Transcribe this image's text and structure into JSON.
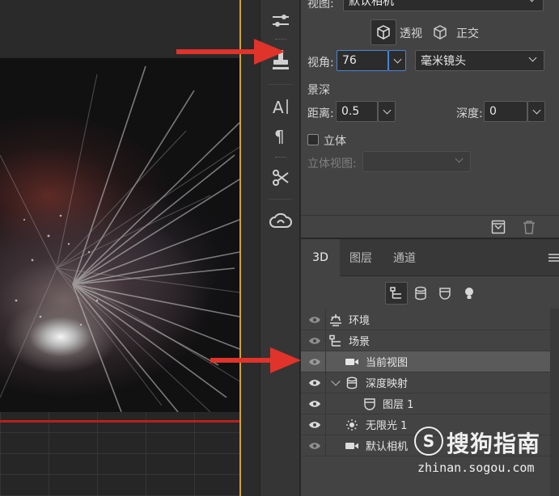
{
  "properties": {
    "view_label": "视图:",
    "view_value": "默认相机",
    "perspective_label": "透视",
    "orthographic_label": "正交",
    "fov_label": "视角:",
    "fov_value": "76",
    "lens_unit": "毫米镜头",
    "dof_heading": "景深",
    "distance_label": "距离:",
    "distance_value": "0.5",
    "depth_label": "深度:",
    "depth_value": "0",
    "stereo_label": "立体",
    "stereo_view_label": "立体视图:"
  },
  "panel3d": {
    "tabs": [
      "3D",
      "图层",
      "通道"
    ],
    "active_tab": "3D",
    "rows": [
      {
        "label": "环境",
        "icon": "environment-icon",
        "indent": 0,
        "visible": true,
        "selected": false
      },
      {
        "label": "场景",
        "icon": "scene-icon",
        "indent": 0,
        "visible": true,
        "selected": false
      },
      {
        "label": "当前视图",
        "icon": "camera-icon",
        "indent": 1,
        "visible": true,
        "selected": true
      },
      {
        "label": "深度映射",
        "icon": "mesh-icon",
        "indent": 1,
        "visible": true,
        "selected": false,
        "expanded": true
      },
      {
        "label": "图层 1",
        "icon": "material-icon",
        "indent": 2,
        "visible": true,
        "selected": false
      },
      {
        "label": "无限光 1",
        "icon": "light-icon",
        "indent": 1,
        "visible": true,
        "selected": false
      },
      {
        "label": "默认相机",
        "icon": "camera-icon",
        "indent": 1,
        "visible": true,
        "selected": false
      }
    ]
  },
  "watermark": {
    "logo_glyph": "S",
    "title": "搜狗指南",
    "url": "zhinan.sogou.com"
  },
  "colors": {
    "panel_bg": "#434343",
    "arrow": "#e0332a",
    "focus": "#4a84d4"
  }
}
